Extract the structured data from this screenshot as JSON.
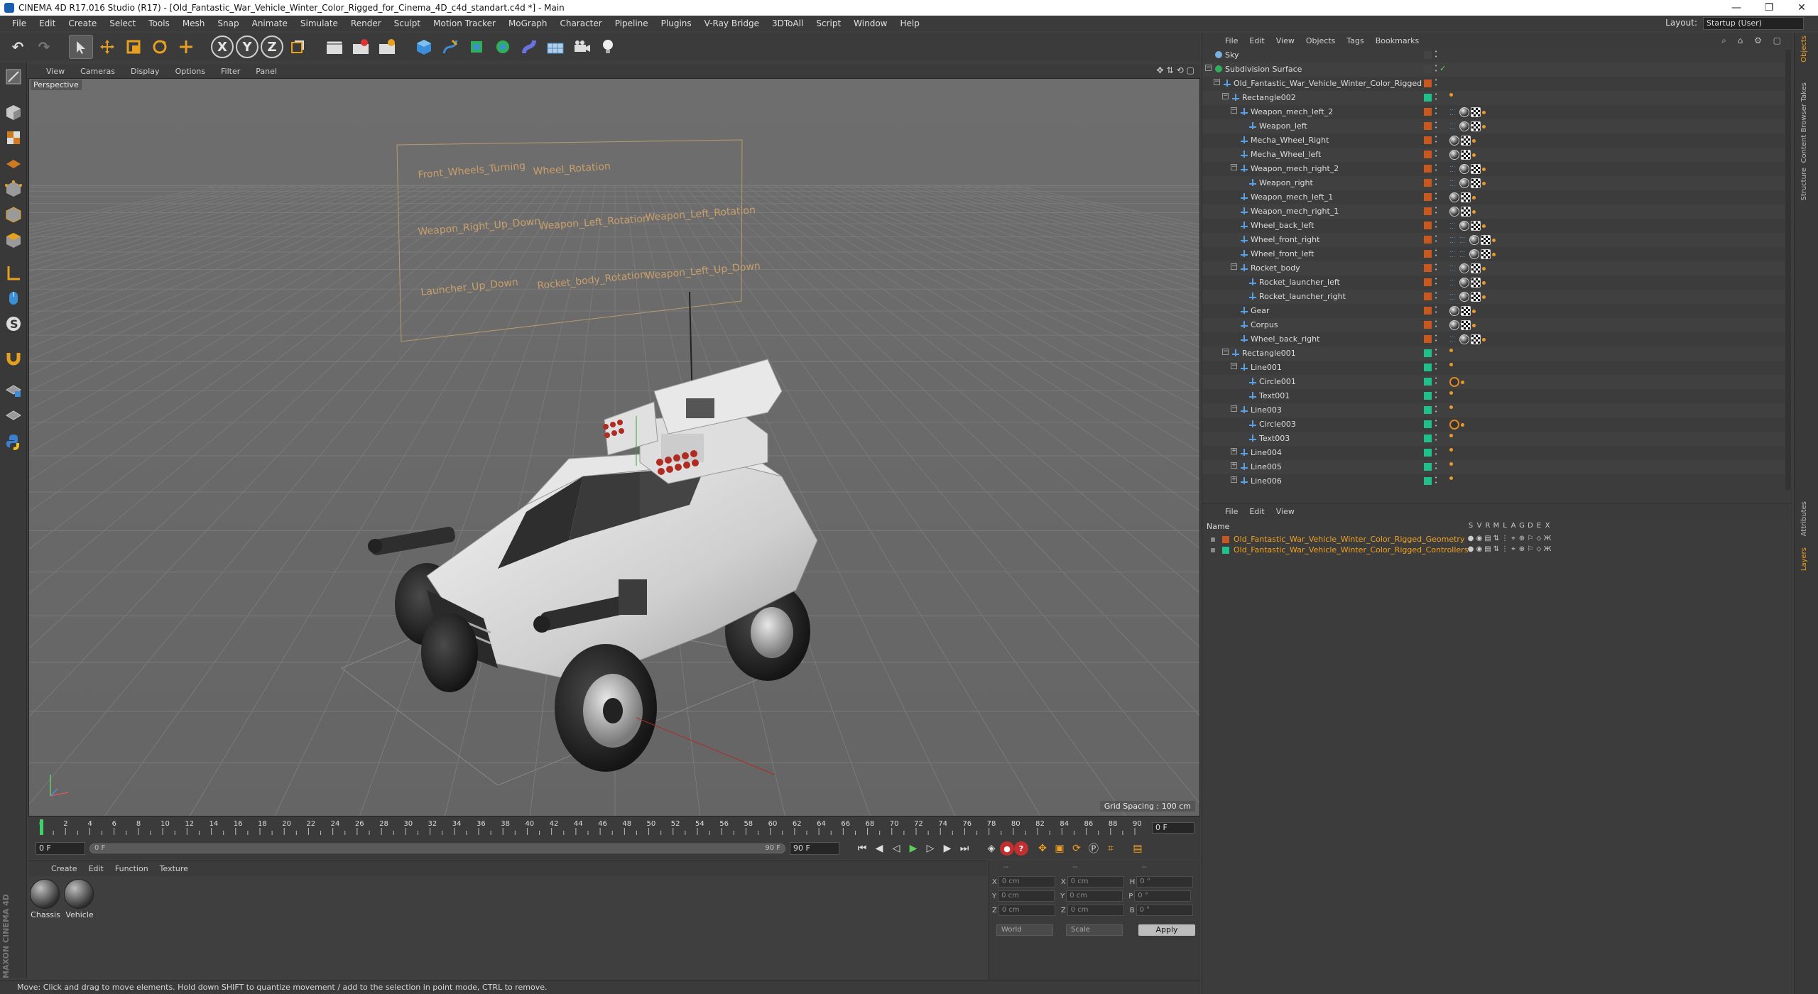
{
  "window": {
    "title": "CINEMA 4D R17.016 Studio (R17) - [Old_Fantastic_War_Vehicle_Winter_Color_Rigged_for_Cinema_4D_c4d_standart.c4d *] - Main",
    "minimize": "—",
    "maximize": "❐",
    "close": "✕"
  },
  "menubar": [
    "File",
    "Edit",
    "Create",
    "Select",
    "Tools",
    "Mesh",
    "Snap",
    "Animate",
    "Simulate",
    "Render",
    "Sculpt",
    "Motion Tracker",
    "MoGraph",
    "Character",
    "Pipeline",
    "Plugins",
    "V-Ray Bridge",
    "3DToAll",
    "Script",
    "Window",
    "Help"
  ],
  "layout": {
    "label": "Layout:",
    "value": "Startup (User)"
  },
  "toolbar": {
    "undo": "↶",
    "redo": "↷",
    "x_axis": "X",
    "y_axis": "Y",
    "z_axis": "Z"
  },
  "viewport": {
    "menu": [
      "View",
      "Cameras",
      "Display",
      "Options",
      "Filter",
      "Panel"
    ],
    "camera_label": "Perspective",
    "grid_spacing": "Grid Spacing : 100 cm",
    "panel_labels": [
      "Front_Wheels_Turning",
      "Wheel_Rotation",
      "Weapon_Right_Up_Down",
      "Weapon_Left_Rotation",
      "Weapon_Left_Rotation",
      "Launcher_Up_Down",
      "Rocket_body_Rotation",
      "Weapon_Left_Up_Down"
    ]
  },
  "timeline": {
    "ticks": [
      "0",
      "2",
      "4",
      "6",
      "8",
      "10",
      "12",
      "14",
      "16",
      "18",
      "20",
      "22",
      "24",
      "26",
      "28",
      "30",
      "32",
      "34",
      "36",
      "38",
      "40",
      "42",
      "44",
      "46",
      "48",
      "50",
      "52",
      "54",
      "56",
      "58",
      "60",
      "62",
      "64",
      "66",
      "68",
      "70",
      "72",
      "74",
      "76",
      "78",
      "80",
      "82",
      "84",
      "86",
      "88",
      "90"
    ],
    "current_frame": "0 F",
    "start_field": "0 F",
    "slider_start": "0 F",
    "slider_end": "90 F",
    "end_field": "90 F"
  },
  "material_manager": {
    "menu": [
      "Create",
      "Edit",
      "Function",
      "Texture"
    ],
    "materials": [
      "Chassis",
      "Vehicle"
    ]
  },
  "coordinates": {
    "header_left": "--",
    "header_mid": "--",
    "header_right": "--",
    "rows": [
      {
        "a": "X",
        "av": "0 cm",
        "b": "X",
        "bv": "0 cm",
        "c": "H",
        "cv": "0 °"
      },
      {
        "a": "Y",
        "av": "0 cm",
        "b": "Y",
        "bv": "0 cm",
        "c": "P",
        "cv": "0 °"
      },
      {
        "a": "Z",
        "av": "0 cm",
        "b": "Z",
        "bv": "0 cm",
        "c": "B",
        "cv": "0 °"
      }
    ],
    "mode1": "World",
    "mode2": "Scale",
    "apply": "Apply"
  },
  "status_text": "Move: Click and drag to move elements. Hold down SHIFT to quantize movement / add to the selection in point mode, CTRL to remove.",
  "object_manager": {
    "menu": [
      "File",
      "Edit",
      "View",
      "Objects",
      "Tags",
      "Bookmarks"
    ],
    "rows": [
      {
        "name": "Sky",
        "indent": 0,
        "exp": "",
        "color": "#444444",
        "tags": []
      },
      {
        "name": "Subdivision Surface",
        "indent": 0,
        "exp": "−",
        "color": "#444444",
        "tags": []
      },
      {
        "name": "Old_Fantastic_War_Vehicle_Winter_Color_Rigged",
        "indent": 1,
        "exp": "−",
        "color": "#c8581f",
        "tags": []
      },
      {
        "name": "Rectangle002",
        "indent": 2,
        "exp": "−",
        "color": "#1fc08a",
        "tags": [
          "dot"
        ]
      },
      {
        "name": "Weapon_mech_left_2",
        "indent": 3,
        "exp": "−",
        "color": "#c8581f",
        "tags": [
          "dots",
          "ball",
          "checker",
          "dot"
        ]
      },
      {
        "name": "Weapon_left",
        "indent": 4,
        "exp": "",
        "color": "#c8581f",
        "tags": [
          "dots",
          "ball",
          "checker",
          "dot"
        ]
      },
      {
        "name": "Mecha_Wheel_Right",
        "indent": 3,
        "exp": "",
        "color": "#c8581f",
        "tags": [
          "ball",
          "checker",
          "dot"
        ]
      },
      {
        "name": "Mecha_Wheel_left",
        "indent": 3,
        "exp": "",
        "color": "#c8581f",
        "tags": [
          "ball",
          "checker",
          "dot"
        ]
      },
      {
        "name": "Weapon_mech_right_2",
        "indent": 3,
        "exp": "−",
        "color": "#c8581f",
        "tags": [
          "dots",
          "ball",
          "checker",
          "dot"
        ]
      },
      {
        "name": "Weapon_right",
        "indent": 4,
        "exp": "",
        "color": "#c8581f",
        "tags": [
          "dots",
          "ball",
          "checker",
          "dot"
        ]
      },
      {
        "name": "Weapon_mech_left_1",
        "indent": 3,
        "exp": "",
        "color": "#c8581f",
        "tags": [
          "ball",
          "checker",
          "dot"
        ]
      },
      {
        "name": "Weapon_mech_right_1",
        "indent": 3,
        "exp": "",
        "color": "#c8581f",
        "tags": [
          "ball",
          "checker",
          "dot"
        ]
      },
      {
        "name": "Wheel_back_left",
        "indent": 3,
        "exp": "",
        "color": "#c8581f",
        "tags": [
          "dots",
          "ball",
          "checker",
          "dot"
        ]
      },
      {
        "name": "Wheel_front_right",
        "indent": 3,
        "exp": "",
        "color": "#c8581f",
        "tags": [
          "dots",
          "dots",
          "ball",
          "checker",
          "dot"
        ]
      },
      {
        "name": "Wheel_front_left",
        "indent": 3,
        "exp": "",
        "color": "#c8581f",
        "tags": [
          "dots",
          "dots",
          "ball",
          "checker",
          "dot"
        ]
      },
      {
        "name": "Rocket_body",
        "indent": 3,
        "exp": "−",
        "color": "#c8581f",
        "tags": [
          "dots",
          "ball",
          "checker",
          "dot"
        ]
      },
      {
        "name": "Rocket_launcher_left",
        "indent": 4,
        "exp": "",
        "color": "#c8581f",
        "tags": [
          "dots",
          "ball",
          "checker",
          "dot"
        ]
      },
      {
        "name": "Rocket_launcher_right",
        "indent": 4,
        "exp": "",
        "color": "#c8581f",
        "tags": [
          "dots",
          "ball",
          "checker",
          "dot"
        ]
      },
      {
        "name": "Gear",
        "indent": 3,
        "exp": "",
        "color": "#c8581f",
        "tags": [
          "ball",
          "checker",
          "dot"
        ]
      },
      {
        "name": "Corpus",
        "indent": 3,
        "exp": "",
        "color": "#c8581f",
        "tags": [
          "ball",
          "checker",
          "dot"
        ]
      },
      {
        "name": "Wheel_back_right",
        "indent": 3,
        "exp": "",
        "color": "#c8581f",
        "tags": [
          "dots",
          "ball",
          "checker",
          "dot"
        ]
      },
      {
        "name": "Rectangle001",
        "indent": 2,
        "exp": "−",
        "color": "#1fc08a",
        "tags": [
          "dot"
        ]
      },
      {
        "name": "Line001",
        "indent": 3,
        "exp": "−",
        "color": "#1fc08a",
        "tags": [
          "dot"
        ]
      },
      {
        "name": "Circle001",
        "indent": 4,
        "exp": "",
        "color": "#1fc08a",
        "tags": [
          "forbid",
          "dot"
        ]
      },
      {
        "name": "Text001",
        "indent": 4,
        "exp": "",
        "color": "#1fc08a",
        "tags": [
          "dot"
        ]
      },
      {
        "name": "Line003",
        "indent": 3,
        "exp": "−",
        "color": "#1fc08a",
        "tags": [
          "dot"
        ]
      },
      {
        "name": "Circle003",
        "indent": 4,
        "exp": "",
        "color": "#1fc08a",
        "tags": [
          "forbid",
          "dot"
        ]
      },
      {
        "name": "Text003",
        "indent": 4,
        "exp": "",
        "color": "#1fc08a",
        "tags": [
          "dot"
        ]
      },
      {
        "name": "Line004",
        "indent": 3,
        "exp": "+",
        "color": "#1fc08a",
        "tags": [
          "dot"
        ]
      },
      {
        "name": "Line005",
        "indent": 3,
        "exp": "+",
        "color": "#1fc08a",
        "tags": [
          "dot"
        ]
      },
      {
        "name": "Line006",
        "indent": 3,
        "exp": "+",
        "color": "#1fc08a",
        "tags": [
          "dot"
        ]
      }
    ]
  },
  "layer_manager": {
    "menu": [
      "File",
      "Edit",
      "View"
    ],
    "name_header": "Name",
    "columns": [
      "S",
      "V",
      "R",
      "M",
      "L",
      "A",
      "G",
      "D",
      "E",
      "X"
    ],
    "layers": [
      {
        "name": "Old_Fantastic_War_Vehicle_Winter_Color_Rigged_Geometry",
        "color": "#c8581f",
        "text_color": "#f0a020"
      },
      {
        "name": "Old_Fantastic_War_Vehicle_Winter_Color_Rigged_Controllers",
        "color": "#1fc08a",
        "text_color": "#f0a020"
      }
    ]
  },
  "right_tabs": [
    "Objects",
    "Takes",
    "Content Browser",
    "Structure",
    "Attributes",
    "Layers"
  ],
  "colors": {
    "accent": "#f0a020",
    "viewport_bg": "#6b6b6b",
    "panel_bg": "#3c3c3c"
  }
}
